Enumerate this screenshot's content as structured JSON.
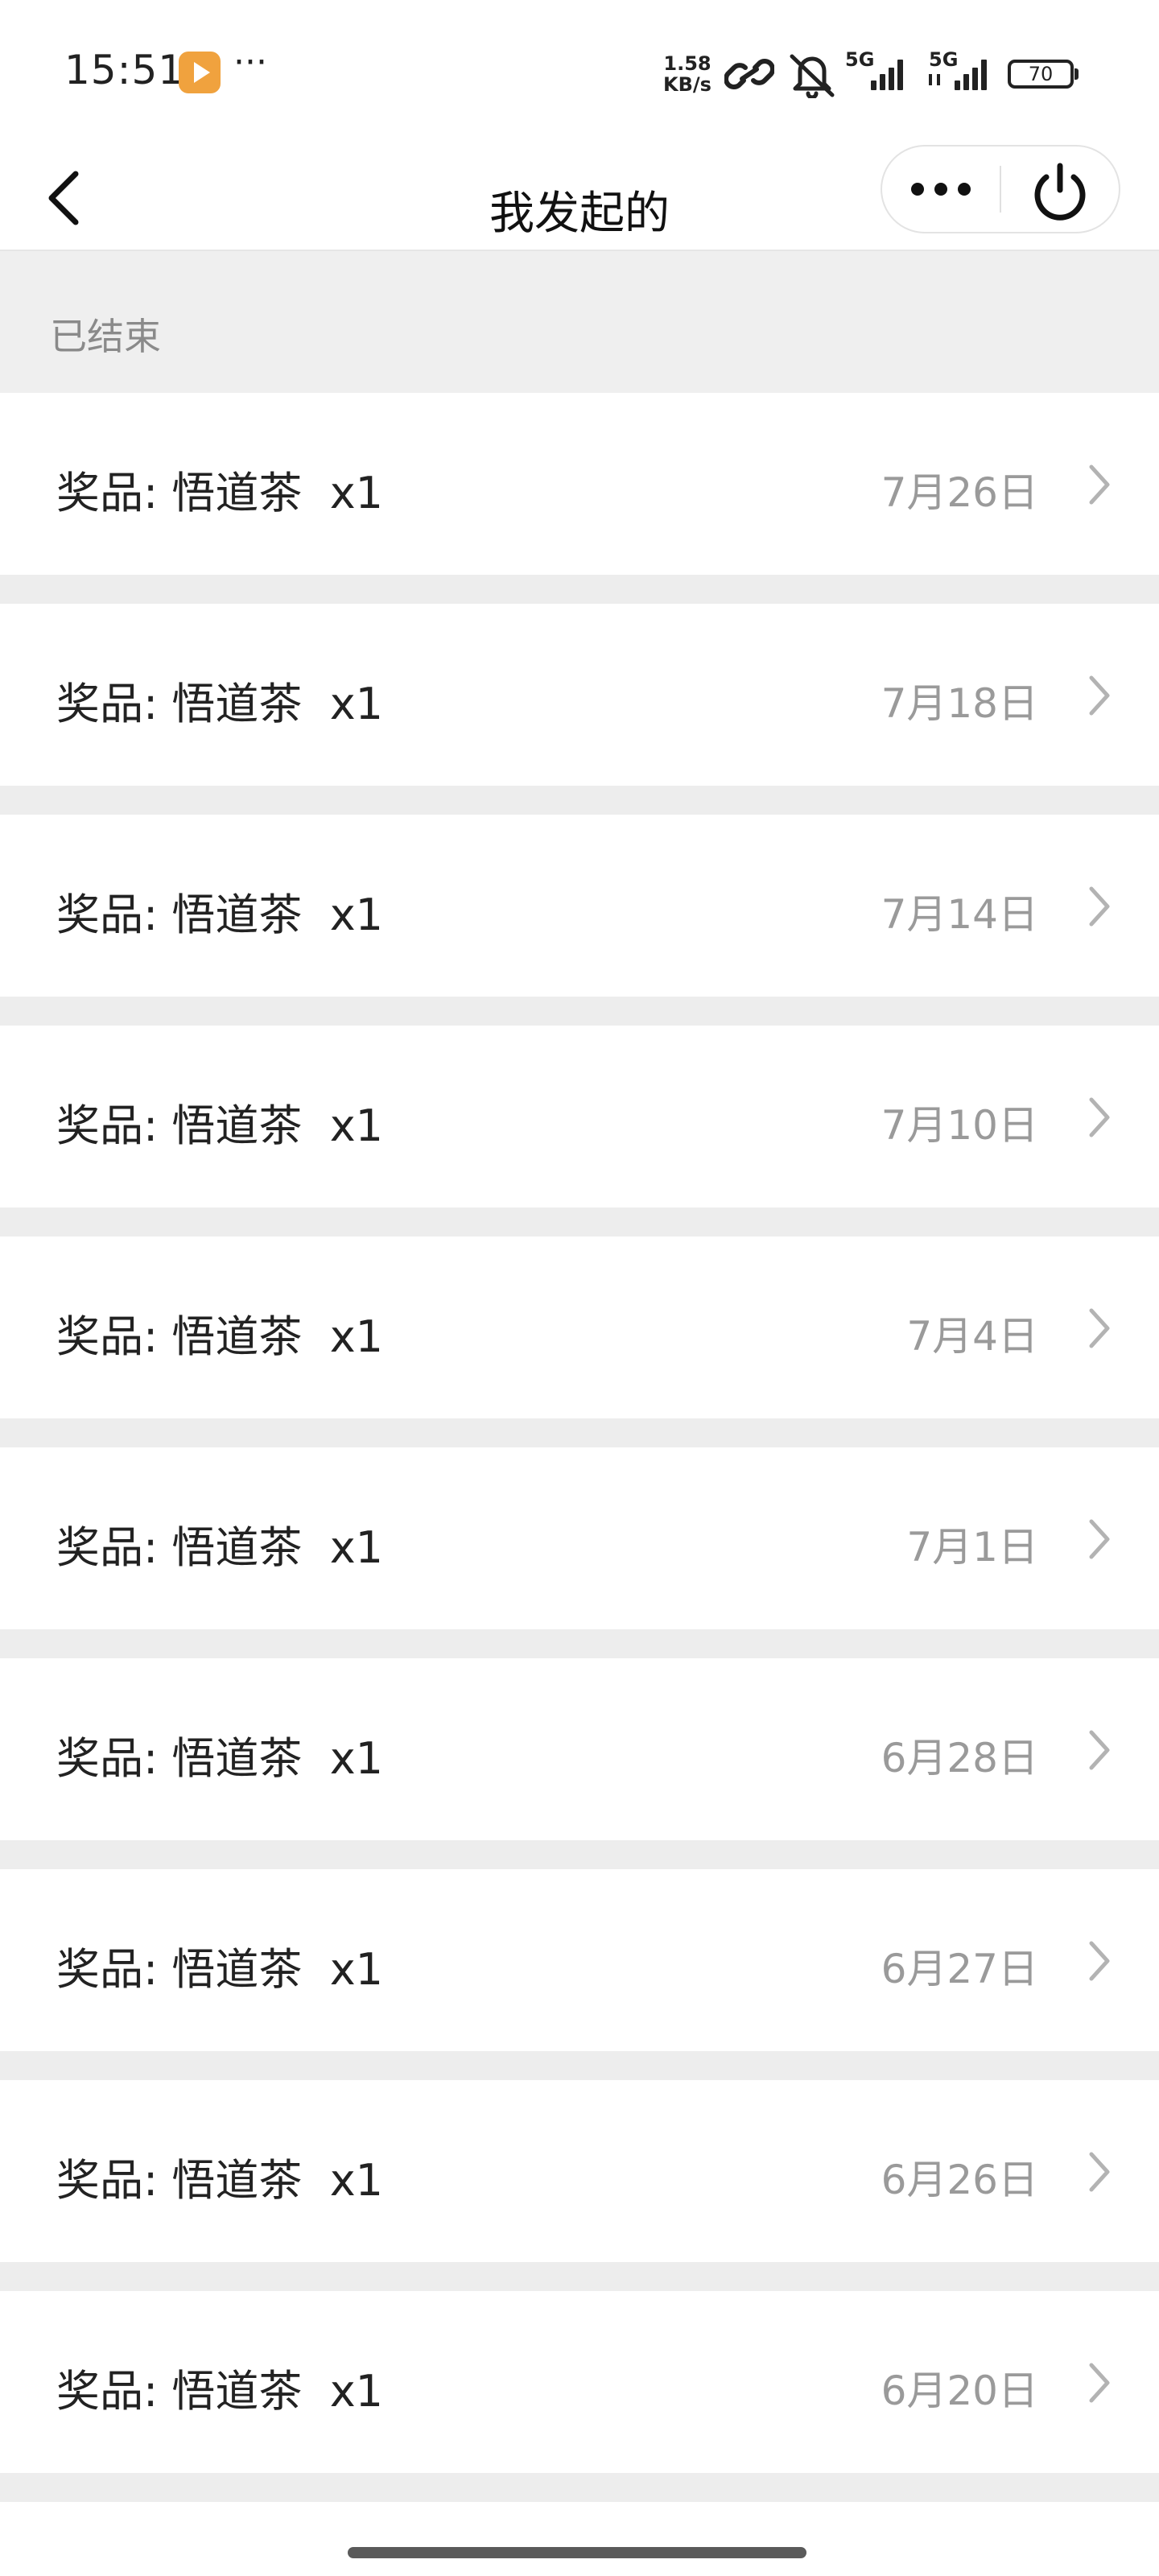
{
  "status_bar": {
    "time": "15:51",
    "more_indicator": "···",
    "net_speed_value": "1.58",
    "net_speed_unit": "KB/s",
    "signal_1_label": "5G",
    "signal_2_label": "5G",
    "battery_level": "70",
    "icons": [
      "app-badge-icon",
      "link-icon",
      "bell-muted-icon",
      "signal-icon",
      "signal-icon",
      "battery-icon"
    ]
  },
  "nav": {
    "title": "我发起的",
    "back_icon": "chevron-left-icon",
    "more_icon": "more-dots-icon",
    "power_icon": "power-icon"
  },
  "section": {
    "title": "已结束"
  },
  "items": [
    {
      "label": "奖品: 悟道茶  x1",
      "date": "7月26日"
    },
    {
      "label": "奖品: 悟道茶  x1",
      "date": "7月18日"
    },
    {
      "label": "奖品: 悟道茶  x1",
      "date": "7月14日"
    },
    {
      "label": "奖品: 悟道茶  x1",
      "date": "7月10日"
    },
    {
      "label": "奖品: 悟道茶  x1",
      "date": "7月4日"
    },
    {
      "label": "奖品: 悟道茶  x1",
      "date": "7月1日"
    },
    {
      "label": "奖品: 悟道茶  x1",
      "date": "6月28日"
    },
    {
      "label": "奖品: 悟道茶  x1",
      "date": "6月27日"
    },
    {
      "label": "奖品: 悟道茶  x1",
      "date": "6月26日"
    },
    {
      "label": "奖品: 悟道茶  x1",
      "date": "6月20日"
    }
  ],
  "colors": {
    "background": "#ededed",
    "surface": "#ffffff",
    "section_text": "#8a8a8a",
    "date_text": "#9a9a9a",
    "chevron": "#b3b3b3"
  }
}
